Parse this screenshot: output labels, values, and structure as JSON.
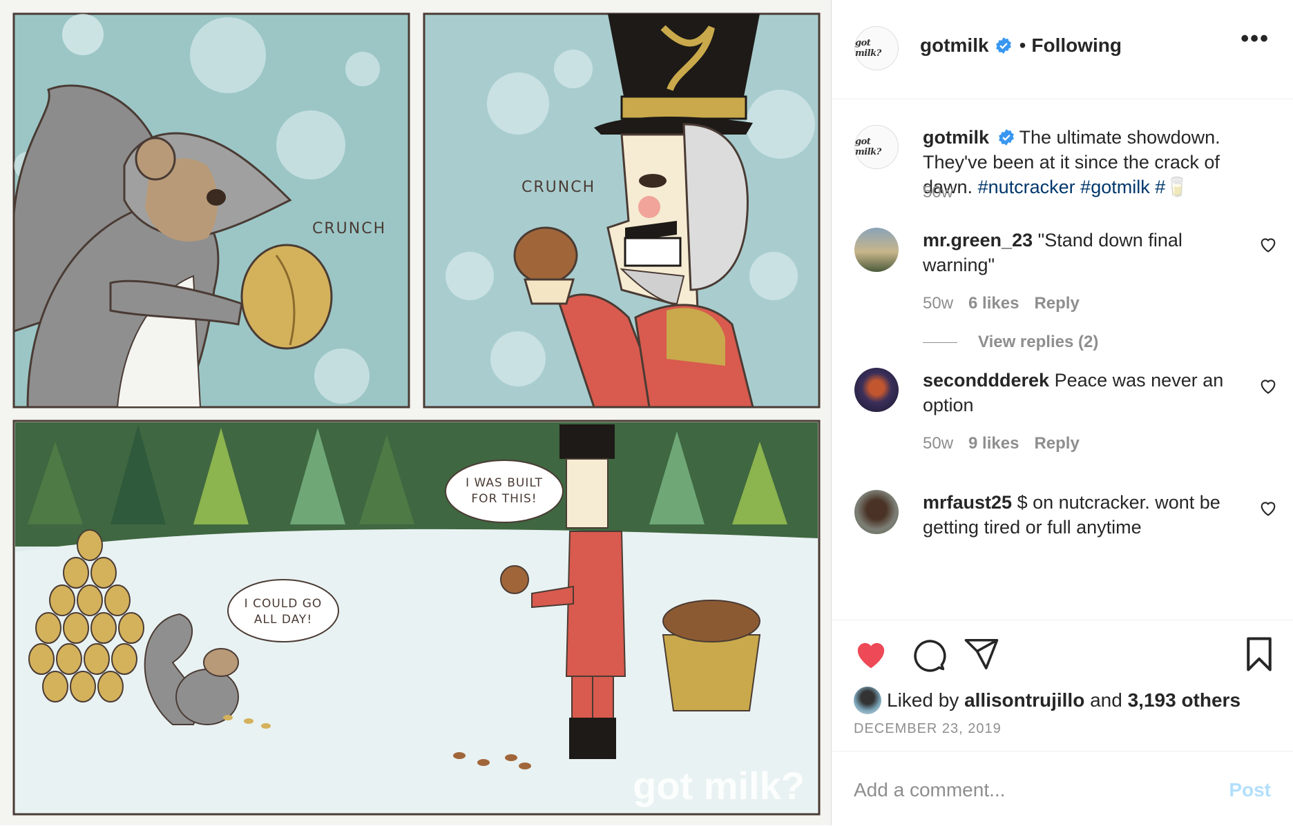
{
  "post": {
    "image_alt": "got milk? comic: squirrel vs nutcracker",
    "speech": {
      "crunch": "CRUNCH",
      "built": [
        "I WAS BUILT",
        "FOR THIS!"
      ],
      "could": [
        "I COULD GO",
        "ALL DAY!"
      ],
      "watermark": "got milk?"
    }
  },
  "header": {
    "avatar_text": "got milk?",
    "username": "gotmilk",
    "separator": "•",
    "follow_status": "Following",
    "more_label": "•••"
  },
  "caption": {
    "avatar_text": "got milk?",
    "username": "gotmilk",
    "text": "The ultimate showdown. They've been at it since the crack of dawn.",
    "hashtags": [
      "#nutcracker",
      "#gotmilk",
      "#🥛"
    ],
    "time": "50w"
  },
  "comments": [
    {
      "username": "mr.green_23",
      "text": "\"Stand down final warning\"",
      "time": "50w",
      "likes": "6 likes",
      "reply": "Reply",
      "view_replies": "View replies (2)"
    },
    {
      "username": "seconddderek",
      "text": "Peace was never an option",
      "time": "50w",
      "likes": "9 likes",
      "reply": "Reply"
    },
    {
      "username": "mrfaust25",
      "text": "$ on nutcracker. wont be getting tired or full anytime"
    }
  ],
  "actions": {
    "liked_by_prefix": "Liked by",
    "liked_by_user": "allisontrujillo",
    "liked_by_mid": "and",
    "liked_by_others": "3,193 others",
    "date": "DECEMBER 23, 2019"
  },
  "add_comment": {
    "placeholder": "Add a comment...",
    "post_label": "Post"
  },
  "colors": {
    "like_red": "#ed4956",
    "verified_blue": "#3897f0",
    "hashtag": "#00376b",
    "post_disabled": "#b2dffc"
  }
}
